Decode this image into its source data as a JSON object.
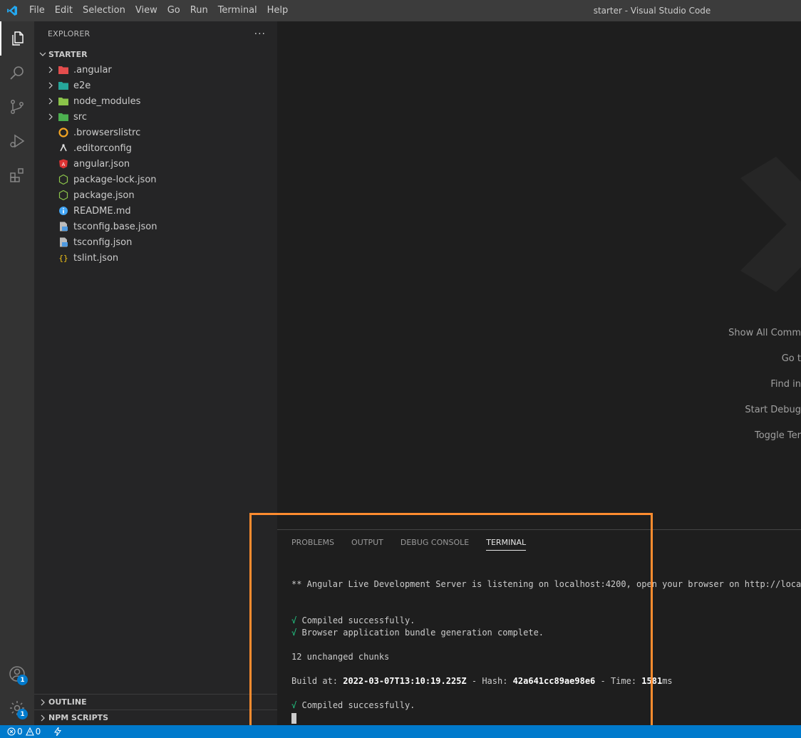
{
  "titlebar": {
    "menu": [
      "File",
      "Edit",
      "Selection",
      "View",
      "Go",
      "Run",
      "Terminal",
      "Help"
    ],
    "window_title": "starter - Visual Studio Code"
  },
  "activitybar": {
    "items": [
      "explorer-icon",
      "search-icon",
      "source-control-icon",
      "run-debug-icon",
      "extensions-icon"
    ],
    "accounts_badge": "1",
    "settings_badge": "1"
  },
  "sidebar": {
    "title": "EXPLORER",
    "more": "···",
    "root": "STARTER",
    "folders": [
      {
        "name": ".angular",
        "color": "#e44d4d"
      },
      {
        "name": "e2e",
        "color": "#26a69a"
      },
      {
        "name": "node_modules",
        "color": "#8bc34a"
      },
      {
        "name": "src",
        "color": "#4caf50"
      }
    ],
    "files": [
      {
        "name": ".browserslistrc",
        "icon": "browserslist-icon",
        "color": "#f5a623"
      },
      {
        "name": ".editorconfig",
        "icon": "editorconfig-icon",
        "color": "#e0e0e0"
      },
      {
        "name": "angular.json",
        "icon": "angular-icon",
        "color": "#dd3333"
      },
      {
        "name": "package-lock.json",
        "icon": "nodejs-icon",
        "color": "#8bc34a"
      },
      {
        "name": "package.json",
        "icon": "nodejs-icon",
        "color": "#8bc34a"
      },
      {
        "name": "README.md",
        "icon": "info-icon",
        "color": "#42a5f5"
      },
      {
        "name": "tsconfig.base.json",
        "icon": "tsconfig-icon",
        "color": "#4f9ae0"
      },
      {
        "name": "tsconfig.json",
        "icon": "tsconfig-icon",
        "color": "#4f9ae0"
      },
      {
        "name": "tslint.json",
        "icon": "json-icon",
        "color": "#f5c518"
      }
    ],
    "outline": "OUTLINE",
    "npm_scripts": "NPM SCRIPTS"
  },
  "editor": {
    "shortcuts": [
      "Show All Comm",
      "Go t",
      "Find in",
      "Start Debug",
      "Toggle Ter"
    ]
  },
  "panel": {
    "tabs": [
      "PROBLEMS",
      "OUTPUT",
      "DEBUG CONSOLE",
      "TERMINAL"
    ],
    "active_tab": "TERMINAL",
    "terminal": {
      "line1": "** Angular Live Development Server is listening on localhost:4200, open your browser on http://localho",
      "check": "√",
      "compiled": "Compiled successfully.",
      "bundle": "Browser application bundle generation complete.",
      "chunks": "12 unchanged chunks",
      "build_prefix": "Build at: ",
      "build_date": "2022-03-07T13:10:19.225Z",
      "hash_prefix": " - Hash: ",
      "hash": "42a641cc89ae98e6",
      "time_prefix": " - Time: ",
      "time": "1581",
      "time_unit": "ms",
      "compiled2": "Compiled successfully."
    }
  },
  "statusbar": {
    "errors": "0",
    "warnings": "0"
  },
  "colors": {
    "accent": "#007acc",
    "highlight": "#ff8c2f"
  }
}
